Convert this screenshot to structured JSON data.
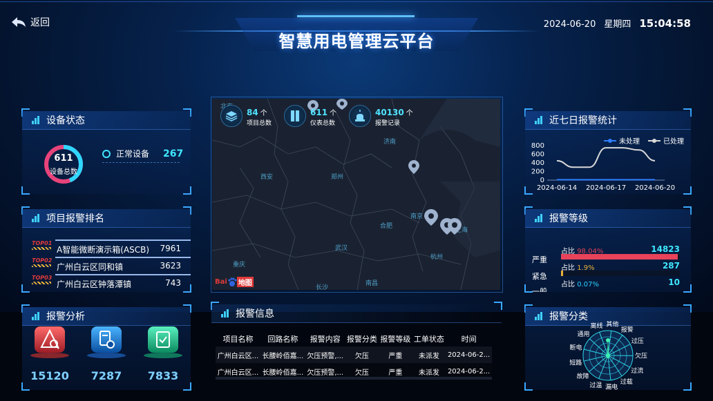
{
  "header": {
    "back_label": "返回",
    "title": "智慧用电管理云平台",
    "date": "2024-06-20",
    "weekday": "星期四",
    "time": "15:04:58"
  },
  "device_status": {
    "title": "设备状态",
    "total": "611",
    "total_label": "设备总数",
    "rows": [
      {
        "label": "正常设备",
        "value": "267"
      }
    ],
    "normal_fraction": 0.44
  },
  "project_ranking": {
    "title": "项目报警排名",
    "items": [
      {
        "rank": "TOP",
        "num": "01",
        "name": "A智能微断演示箱(ASCB)",
        "value": "7961"
      },
      {
        "rank": "TOP",
        "num": "02",
        "name": "广州白云区同和镇",
        "value": "3623"
      },
      {
        "rank": "TOP",
        "num": "03",
        "name": "广州白云区钟落潭镇",
        "value": "743"
      }
    ]
  },
  "alarm_analysis": {
    "title": "报警分析",
    "items": [
      {
        "value": "15120",
        "color": "#e0413f"
      },
      {
        "value": "7287",
        "color": "#1e8ae8"
      },
      {
        "value": "7833",
        "color": "#1ec08c"
      }
    ]
  },
  "map": {
    "stats": [
      {
        "value": "84",
        "unit": "个",
        "label": "项目总数"
      },
      {
        "value": "611",
        "unit": "个",
        "label": "仪表总数"
      },
      {
        "value": "40130",
        "unit": "个",
        "label": "报警记录"
      }
    ],
    "cities": [
      "西安",
      "郑州",
      "济南",
      "合肥",
      "南京",
      "武汉",
      "杭州",
      "重庆",
      "长沙",
      "南昌",
      "上海",
      "北京"
    ],
    "logo_text": "Bai",
    "logo_text2": "地图"
  },
  "alarm_info": {
    "title": "报警信息",
    "columns": [
      "项目名称",
      "回路名称",
      "报警内容",
      "报警分类",
      "报警等级",
      "工单状态",
      "时间"
    ],
    "rows": [
      [
        "广州白云区...",
        "长腰岭佰嘉...",
        "欠压预警,...",
        "欠压",
        "严重",
        "未派发",
        "2024-06-2..."
      ],
      [
        "广州白云区...",
        "长腰岭佰嘉...",
        "欠压预警,...",
        "欠压",
        "严重",
        "未派发",
        "2024-06-2..."
      ]
    ]
  },
  "weekly": {
    "title": "近七日报警统计",
    "legend": [
      "未处理",
      "已处理"
    ],
    "chart_data": {
      "type": "line",
      "x_ticks": [
        "2024-06-14",
        "2024-06-17",
        "2024-06-20"
      ],
      "y_ticks": [
        "800",
        "600",
        "400",
        "200",
        "0"
      ],
      "ylim": [
        0,
        800
      ],
      "series": [
        {
          "name": "未处理",
          "values": [
            10,
            10,
            10,
            10,
            10,
            10,
            10
          ],
          "color": "#2f7dff"
        },
        {
          "name": "已处理",
          "values": [
            450,
            300,
            300,
            750,
            750,
            700,
            450
          ],
          "color": "#d9d9d9"
        }
      ]
    }
  },
  "alarm_level": {
    "title": "报警等级",
    "labels": [
      "严重",
      "紧急",
      "一般"
    ],
    "rows": [
      {
        "prefix": "占比",
        "pct": "98.04%",
        "count": "14823",
        "color": "#e8435a",
        "pct_color": "#e8435a",
        "fraction": 0.98
      },
      {
        "prefix": "占比",
        "pct": "1.9%",
        "count": "287",
        "color": "#e8b23a",
        "pct_color": "#e8b23a",
        "fraction": 0.019
      },
      {
        "prefix": "占比",
        "pct": "0.07%",
        "count": "10",
        "color": "#2fd0ff",
        "pct_color": "#2fd0ff",
        "fraction": 0.007
      }
    ]
  },
  "alarm_category": {
    "title": "报警分类",
    "labels": [
      "过压",
      "欠压",
      "过流",
      "过载",
      "漏电",
      "过温",
      "故障",
      "短路",
      "断电",
      "通用",
      "离线",
      "其他",
      "报警"
    ]
  }
}
